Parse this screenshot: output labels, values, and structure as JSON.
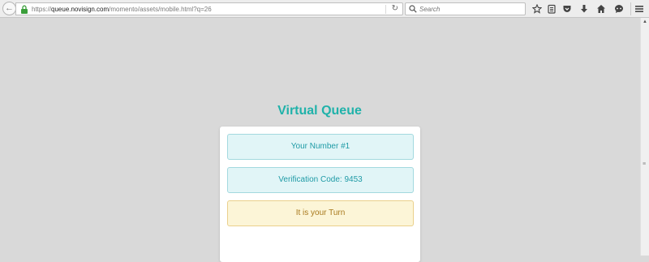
{
  "browser": {
    "url": {
      "scheme": "https://",
      "host": "queue.novisign.com",
      "path": "/momento/assets/mobile.html?q=26"
    },
    "search": {
      "placeholder": "Search"
    },
    "toolbar_icons": [
      "star-icon",
      "reading-list-icon",
      "pocket-icon",
      "download-icon",
      "home-icon",
      "chat-icon",
      "menu-icon"
    ]
  },
  "page": {
    "title": "Virtual Queue",
    "number_label": "Your Number #1",
    "verification_label": "Verification Code: 9453",
    "status_label": "It is your Turn"
  },
  "colors": {
    "title": "#20b2aa",
    "info_bg": "#e1f5f7",
    "info_text": "#1f9ba6",
    "warn_bg": "#fcf5d7",
    "warn_text": "#a8791d",
    "page_bg": "#d9d9d9"
  }
}
